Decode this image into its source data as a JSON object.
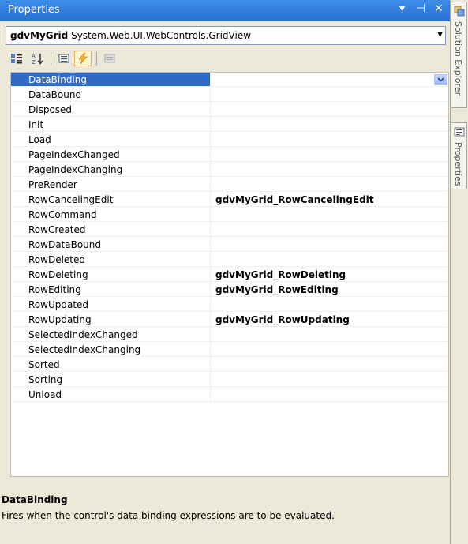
{
  "window": {
    "title": "Properties",
    "buttons": {
      "dropdown": "▾",
      "pin": "⊣",
      "close": "✕"
    }
  },
  "object_selector": {
    "name": "gdvMyGrid",
    "type": "System.Web.UI.WebControls.GridView"
  },
  "toolbar": {
    "buttons": [
      "categorized-icon",
      "alphabetical-icon",
      "properties-icon",
      "events-icon",
      "property-pages-icon"
    ],
    "active": "events-icon"
  },
  "events": [
    {
      "name": "DataBinding",
      "handler": "",
      "selected": true
    },
    {
      "name": "DataBound",
      "handler": ""
    },
    {
      "name": "Disposed",
      "handler": ""
    },
    {
      "name": "Init",
      "handler": ""
    },
    {
      "name": "Load",
      "handler": ""
    },
    {
      "name": "PageIndexChanged",
      "handler": ""
    },
    {
      "name": "PageIndexChanging",
      "handler": ""
    },
    {
      "name": "PreRender",
      "handler": ""
    },
    {
      "name": "RowCancelingEdit",
      "handler": "gdvMyGrid_RowCancelingEdit"
    },
    {
      "name": "RowCommand",
      "handler": ""
    },
    {
      "name": "RowCreated",
      "handler": ""
    },
    {
      "name": "RowDataBound",
      "handler": ""
    },
    {
      "name": "RowDeleted",
      "handler": ""
    },
    {
      "name": "RowDeleting",
      "handler": "gdvMyGrid_RowDeleting"
    },
    {
      "name": "RowEditing",
      "handler": "gdvMyGrid_RowEditing"
    },
    {
      "name": "RowUpdated",
      "handler": ""
    },
    {
      "name": "RowUpdating",
      "handler": "gdvMyGrid_RowUpdating"
    },
    {
      "name": "SelectedIndexChanged",
      "handler": ""
    },
    {
      "name": "SelectedIndexChanging",
      "handler": ""
    },
    {
      "name": "Sorted",
      "handler": ""
    },
    {
      "name": "Sorting",
      "handler": ""
    },
    {
      "name": "Unload",
      "handler": ""
    }
  ],
  "description": {
    "title": "DataBinding",
    "text": "Fires when the control's data binding expressions are to be evaluated."
  },
  "dock_tabs": [
    {
      "label": "Solution Explorer",
      "icon": "solution-explorer-icon"
    },
    {
      "label": "Properties",
      "icon": "properties-window-icon"
    }
  ],
  "colors": {
    "titlebar": "#2a6fd0",
    "selection": "#316ac5",
    "panel_bg": "#ece9d8"
  }
}
